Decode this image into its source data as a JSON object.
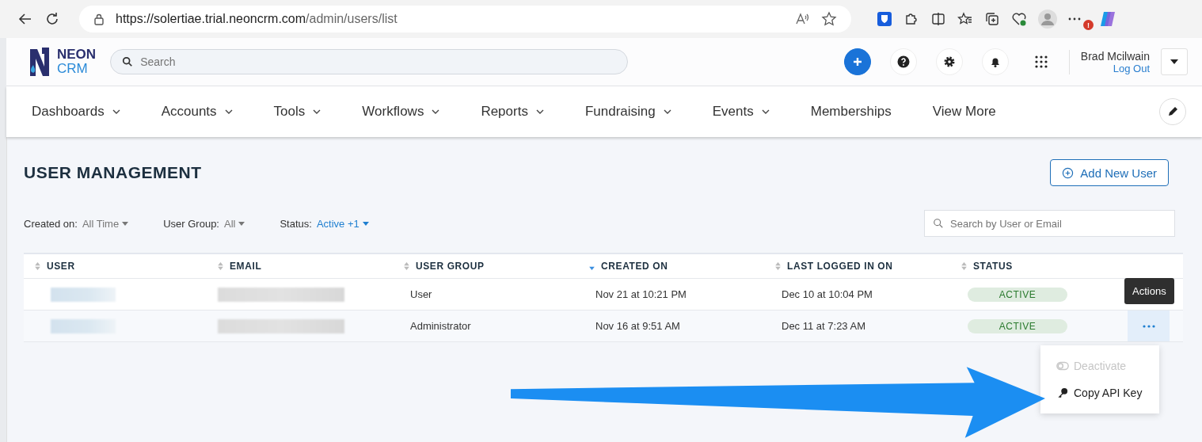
{
  "browser": {
    "url_host": "https://solertiae.trial.neoncrm.com",
    "url_path": "/admin/users/list",
    "profile_badge": "!"
  },
  "header": {
    "logo": {
      "line1": "NEON",
      "line2": "CRM"
    },
    "search": {
      "placeholder": "Search"
    },
    "user_name": "Brad Mcilwain",
    "logout": "Log Out"
  },
  "nav": [
    {
      "label": "Dashboards",
      "has_menu": true
    },
    {
      "label": "Accounts",
      "has_menu": true
    },
    {
      "label": "Tools",
      "has_menu": true
    },
    {
      "label": "Workflows",
      "has_menu": true
    },
    {
      "label": "Reports",
      "has_menu": true
    },
    {
      "label": "Fundraising",
      "has_menu": true
    },
    {
      "label": "Events",
      "has_menu": true
    },
    {
      "label": "Memberships",
      "has_menu": false
    },
    {
      "label": "View More",
      "has_menu": false
    }
  ],
  "page": {
    "title": "USER MANAGEMENT",
    "add_button": "Add New User"
  },
  "filters": [
    {
      "label": "Created on:",
      "value": "All Time",
      "active": false
    },
    {
      "label": "User Group:",
      "value": "All",
      "active": false
    },
    {
      "label": "Status:",
      "value": "Active +1",
      "active": true
    }
  ],
  "table_search": {
    "placeholder": "Search by User or Email"
  },
  "table": {
    "columns": [
      {
        "label": "USER",
        "sorted": false
      },
      {
        "label": "EMAIL",
        "sorted": false
      },
      {
        "label": "USER GROUP",
        "sorted": false
      },
      {
        "label": "CREATED ON",
        "sorted": true
      },
      {
        "label": "LAST LOGGED IN ON",
        "sorted": false
      },
      {
        "label": "STATUS",
        "sorted": false
      }
    ],
    "rows": [
      {
        "user_group": "User",
        "created_on": "Nov 21 at 10:21 PM",
        "last_logged_in": "Dec 10 at 10:04 PM",
        "status": "ACTIVE",
        "hovered": false
      },
      {
        "user_group": "Administrator",
        "created_on": "Nov 16 at 9:51 AM",
        "last_logged_in": "Dec 11 at 7:23 AM",
        "status": "ACTIVE",
        "hovered": true
      }
    ]
  },
  "tooltip": "Actions",
  "actions_menu": [
    {
      "label": "Deactivate",
      "kind": "toggle",
      "disabled": true
    },
    {
      "label": "Copy API Key",
      "kind": "key",
      "disabled": false
    }
  ]
}
